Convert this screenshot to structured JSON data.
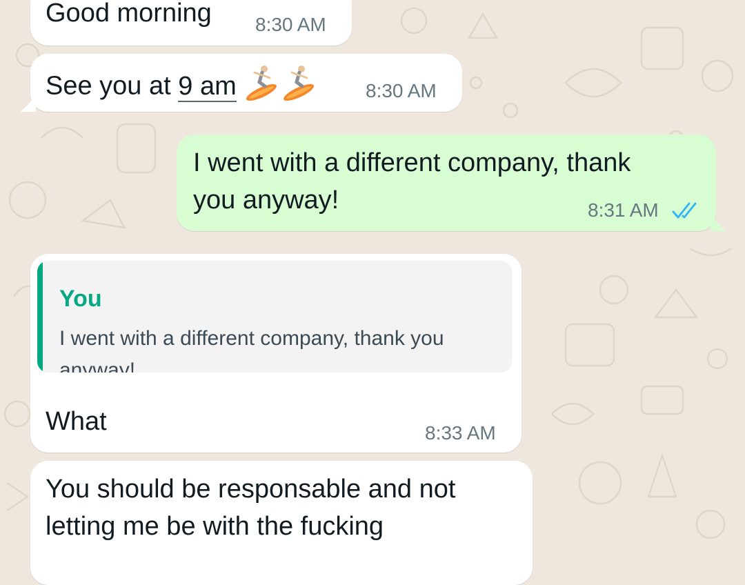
{
  "colors": {
    "wallpaper": "#efe7dd",
    "incoming_bubble": "#ffffff",
    "outgoing_bubble": "#d9fdd3",
    "quote_accent": "#06a884",
    "read_ticks": "#34b7f1"
  },
  "messages": [
    {
      "id": "m1",
      "direction": "incoming",
      "text": "Good morning",
      "time": "8:30 AM"
    },
    {
      "id": "m2",
      "direction": "incoming",
      "text_before": "See you at ",
      "link_text": "9 am",
      "emoji": [
        "surfer-emoji",
        "surfer-emoji"
      ],
      "time": "8:30 AM"
    },
    {
      "id": "m3",
      "direction": "outgoing",
      "text_line1": "I went with a different company, thank",
      "text_line2": "you anyway!",
      "time": "8:31 AM",
      "status_icon": "double-check-read-icon"
    },
    {
      "id": "m4",
      "direction": "incoming",
      "quote": {
        "author": "You",
        "text": "I went with a different company, thank you anyway!"
      },
      "text": "What",
      "time": "8:33 AM"
    },
    {
      "id": "m5",
      "direction": "incoming",
      "text_line1": "You should be responsable and not",
      "text_line2": "letting me be with the fucking"
    }
  ]
}
